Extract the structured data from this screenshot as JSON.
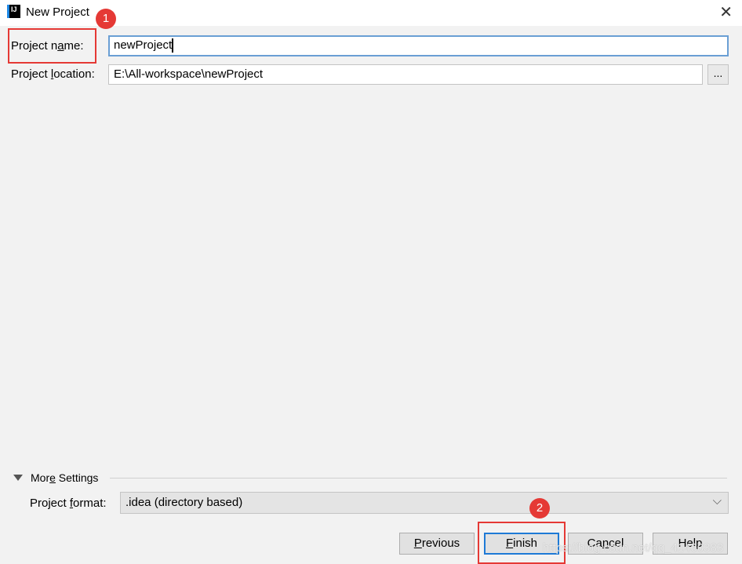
{
  "window": {
    "title": "New Project",
    "close_icon": "close-icon",
    "app_icon": "intellij-idea-icon",
    "app_icon_text": "IJ"
  },
  "form": {
    "name_label_pre": "Project n",
    "name_label_u": "a",
    "name_label_post": "me:",
    "name_value": "newProject",
    "location_label_pre": "Project ",
    "location_label_u": "l",
    "location_label_post": "ocation:",
    "location_value": "E:\\All-workspace\\newProject",
    "browse_label": "..."
  },
  "more_settings": {
    "label_pre": "Mor",
    "label_u": "e",
    "label_post": " Settings",
    "format_label_pre": "Project ",
    "format_label_u": "f",
    "format_label_post": "ormat:",
    "format_value": ".idea (directory based)"
  },
  "buttons": {
    "previous_u": "P",
    "previous_rest": "revious",
    "finish_u": "F",
    "finish_rest": "inish",
    "cancel_pre": "Ca",
    "cancel_u": "n",
    "cancel_post": "cel",
    "help": "Help"
  },
  "annotations": {
    "badge1": "1",
    "badge2": "2",
    "color": "#e53935"
  },
  "watermark": "https://blog.csdn.net/qq_41460383"
}
